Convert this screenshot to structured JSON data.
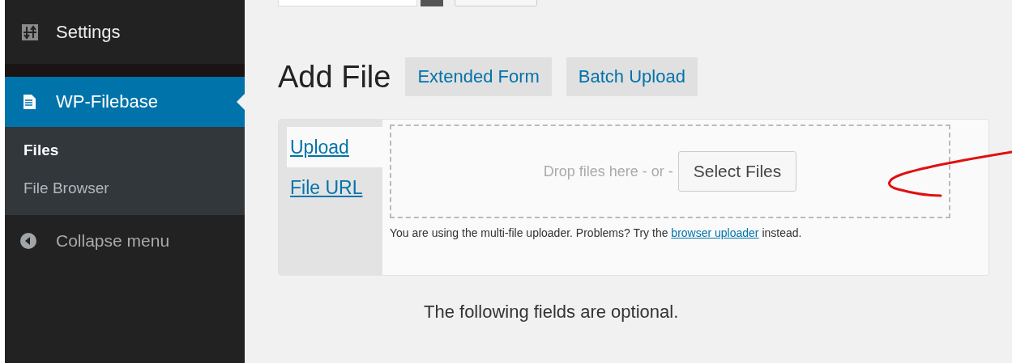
{
  "sidebar": {
    "items": [
      {
        "label": "Settings",
        "kind": "settings",
        "selected": false
      },
      {
        "label": "WP-Filebase",
        "kind": "files",
        "selected": true,
        "children": [
          {
            "label": "Files",
            "selected": true
          },
          {
            "label": "File Browser",
            "selected": false
          }
        ]
      }
    ],
    "collapse": {
      "label": "Collapse menu"
    }
  },
  "page": {
    "title": "Add File",
    "actions": [
      "Extended Form",
      "Batch Upload"
    ]
  },
  "uploader": {
    "tabs": [
      {
        "label": "Upload",
        "selected": true
      },
      {
        "label": "File URL",
        "selected": false
      }
    ],
    "drop_hint": "Drop files here - or -",
    "select_button": "Select Files",
    "note_before": "You are using the multi-file uploader. Problems? Try the",
    "note_link": "browser uploader",
    "note_after": "instead."
  },
  "optional_note": "The following fields are optional."
}
